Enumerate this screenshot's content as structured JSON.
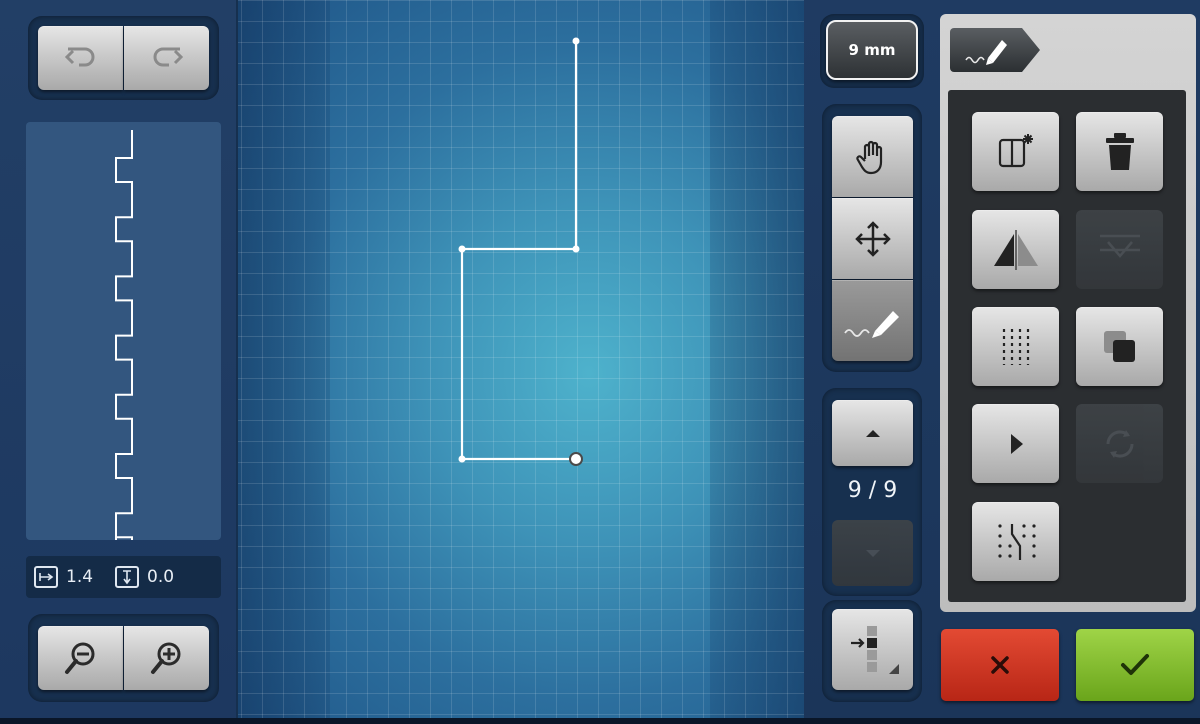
{
  "stitch_size_label": "9 mm",
  "readout": {
    "width_value": "1.4",
    "length_value": "0.0"
  },
  "pattern_counter": "9/9",
  "icons": {
    "undo": "undo-icon",
    "redo": "redo-icon",
    "zoom_out": "zoom-out-icon",
    "zoom_in": "zoom-in-icon",
    "hand": "hand-icon",
    "move": "move-icon",
    "draw": "draw-icon",
    "new_point": "new-point-icon",
    "delete": "trash-icon",
    "mirror": "mirror-icon",
    "align": "align-icon",
    "stitch_grid": "stitch-grid-icon",
    "duplicate": "duplicate-icon",
    "play": "play-icon",
    "repeat": "repeat-icon",
    "stitch_path": "stitch-path-icon",
    "layout": "layout-icon",
    "cancel": "close-icon",
    "confirm": "check-icon"
  },
  "colors": {
    "cancel": "#c9311e",
    "confirm": "#82bc2e",
    "canvas_center": "#4eb2cc",
    "panel": "#1f3b62"
  }
}
